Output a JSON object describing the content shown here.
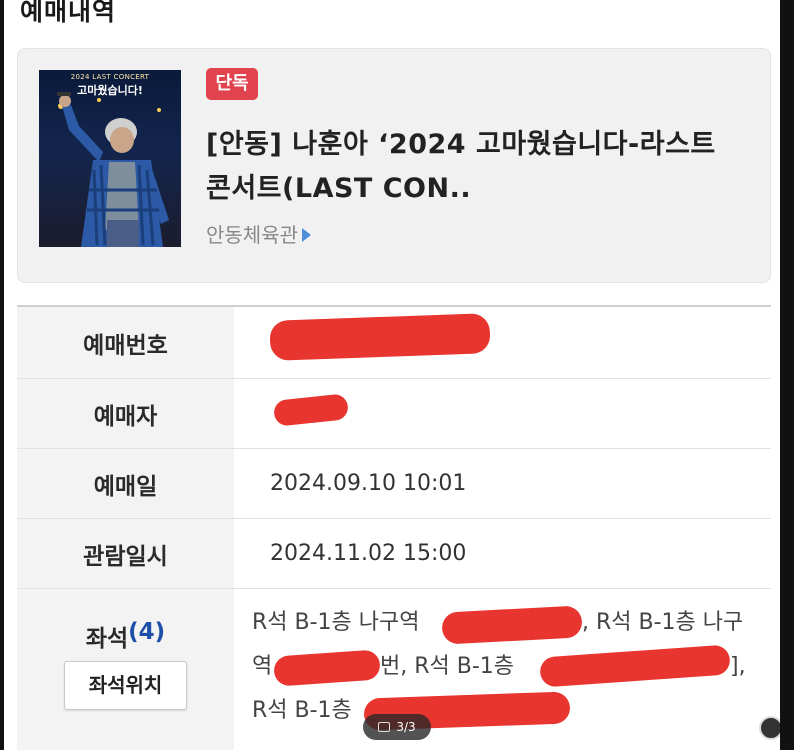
{
  "page": {
    "title": "예매내역"
  },
  "event": {
    "poster": {
      "top_text": "2024 LAST CONCERT",
      "title_text": "고마웠습니다!"
    },
    "badge": "단독",
    "title": "[안동] 나훈아 ‘2024 고마웠습니다-라스트 콘서트(LAST CON..",
    "venue": "안동체육관"
  },
  "details": {
    "reservation_number": {
      "label": "예매번호",
      "value": ""
    },
    "booker": {
      "label": "예매자",
      "value": ""
    },
    "booking_date": {
      "label": "예매일",
      "value": "2024.09.10 10:01"
    },
    "show_datetime": {
      "label": "관람일시",
      "value": "2024.11.02 15:00"
    },
    "seats": {
      "label": "좌석",
      "count": "(4)",
      "count_number": "4",
      "button_label": "좌석위치",
      "line1_a": "R석 B-1층 나구역",
      "line1_b": ", R석 B-1층 나구",
      "line2_a": "역",
      "line2_b": "번, R석 B-1층",
      "line2_c": "],",
      "line3_a": "R석 B-1층"
    }
  },
  "viewer": {
    "page_indicator": "3/3"
  },
  "colors": {
    "badge": "#e0424e",
    "redaction": "#e8352f",
    "accent_link": "#4b8fd8",
    "seat_count": "#1e4fa8"
  }
}
